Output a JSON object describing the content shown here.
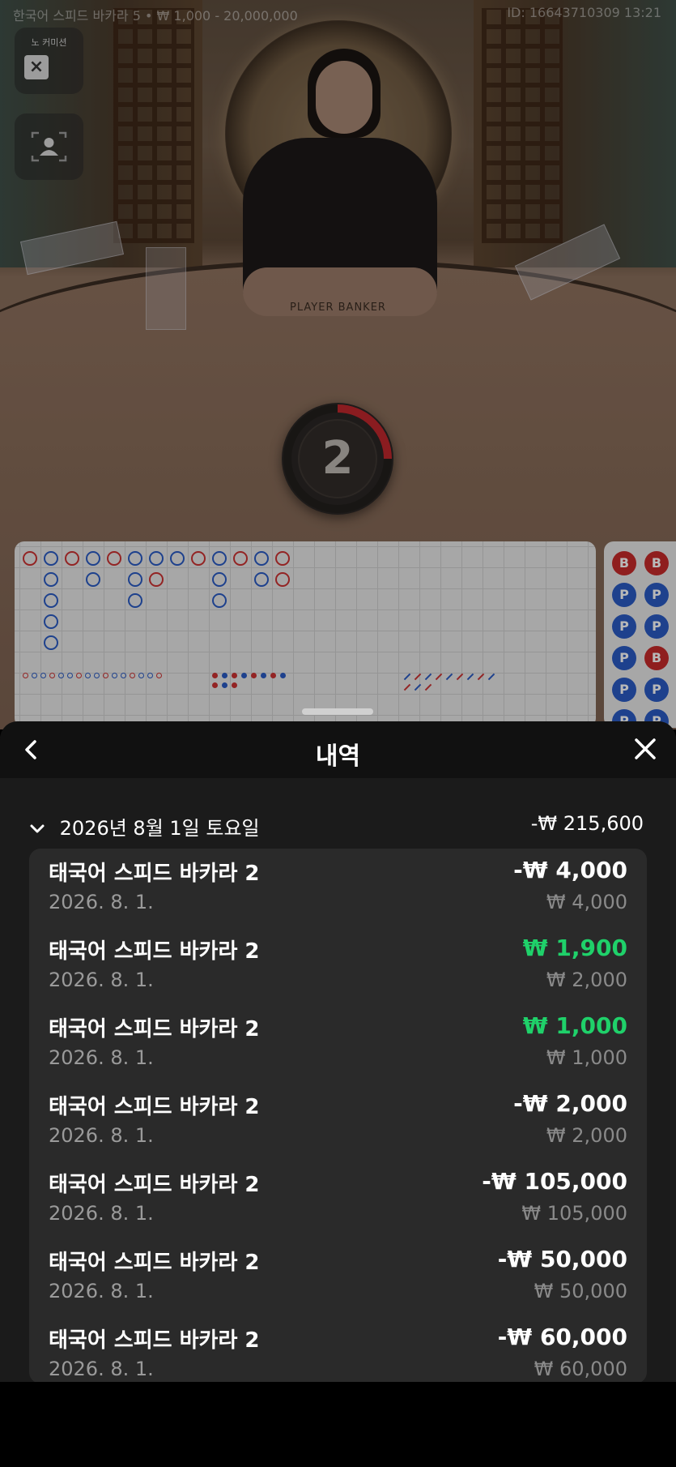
{
  "top_bar": {
    "table_info": "한국어 스피드 바카라 5 • ₩ 1,000 - 20,000,000",
    "game_id": "ID: 16643710309 13:21"
  },
  "side_controls": {
    "no_commission_label": "노 커미션"
  },
  "table": {
    "felt_text": "PLAYER      BANKER"
  },
  "timer": {
    "seconds": "2",
    "progress_fraction": 0.25
  },
  "roadmap": {
    "big_road_letters": [
      "B",
      "B",
      "P",
      "P",
      "P",
      "P",
      "P",
      "B",
      "P",
      "P",
      "P",
      "P"
    ]
  },
  "history_sheet": {
    "title": "내역",
    "date_group": {
      "date": "2026년 8월 1일 토요일",
      "total": "-₩ 215,600"
    },
    "items": [
      {
        "name": "태국어 스피드 바카라 2",
        "date": "2026. 8. 1.",
        "amount": "-₩ 4,000",
        "stake": "₩ 4,000",
        "win": false
      },
      {
        "name": "태국어 스피드 바카라 2",
        "date": "2026. 8. 1.",
        "amount": "₩ 1,900",
        "stake": "₩ 2,000",
        "win": true
      },
      {
        "name": "태국어 스피드 바카라 2",
        "date": "2026. 8. 1.",
        "amount": "₩ 1,000",
        "stake": "₩ 1,000",
        "win": true
      },
      {
        "name": "태국어 스피드 바카라 2",
        "date": "2026. 8. 1.",
        "amount": "-₩ 2,000",
        "stake": "₩ 2,000",
        "win": false
      },
      {
        "name": "태국어 스피드 바카라 2",
        "date": "2026. 8. 1.",
        "amount": "-₩ 105,000",
        "stake": "₩ 105,000",
        "win": false
      },
      {
        "name": "태국어 스피드 바카라 2",
        "date": "2026. 8. 1.",
        "amount": "-₩ 50,000",
        "stake": "₩ 50,000",
        "win": false
      },
      {
        "name": "태국어 스피드 바카라 2",
        "date": "2026. 8. 1.",
        "amount": "-₩ 60,000",
        "stake": "₩ 60,000",
        "win": false
      }
    ]
  },
  "colors": {
    "win_green": "#1fd16a",
    "banker_red": "#c62a2a",
    "player_blue": "#2a5bc4",
    "timer_red": "#c0272d"
  },
  "icons": {
    "back": "chevron-left-icon",
    "close": "close-icon",
    "expand": "chevron-down-icon",
    "avatar": "person-icon"
  }
}
